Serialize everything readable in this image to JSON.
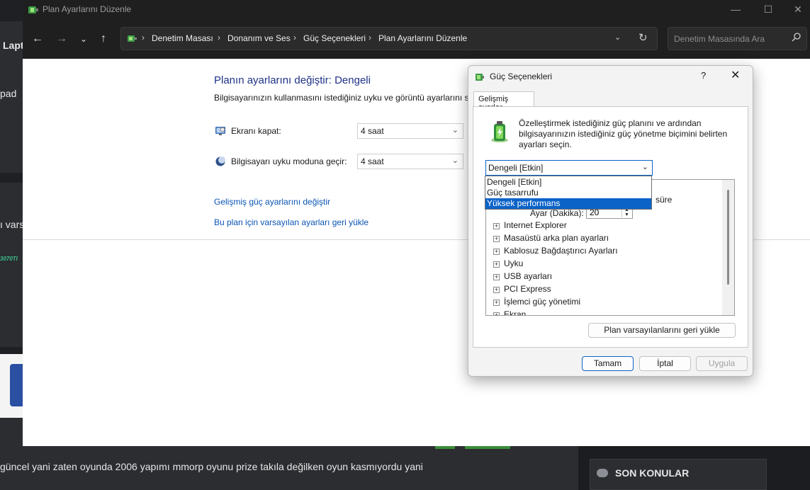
{
  "background": {
    "left_texts": [
      "Lapt",
      "pad",
      "ı vars"
    ],
    "green_code": "3070TI",
    "bottom_text": "güncel yani zaten oyunda 2006 yapımı mmorp oyunu prize takıla değilken oyun kasmıyordu yani",
    "son_konular": "SON KONULAR"
  },
  "window": {
    "title": "Plan Ayarlarını Düzenle",
    "breadcrumbs": [
      "Denetim Masası",
      "Donanım ve Ses",
      "Güç Seçenekleri",
      "Plan Ayarlarını Düzenle"
    ],
    "search_placeholder": "Denetim Masasında Ara"
  },
  "page": {
    "title": "Planın ayarlarını değiştir: Dengeli",
    "description": "Bilgisayarınızın kullanmasını istediğiniz uyku ve görüntü ayarlarını seçin.",
    "settings": [
      {
        "label": "Ekranı kapat:",
        "value": "4 saat",
        "icon": "monitor-icon"
      },
      {
        "label": "Bilgisayarı uyku moduna geçir:",
        "value": "4 saat",
        "icon": "moon-icon"
      }
    ],
    "links": [
      "Gelişmiş güç ayarlarını değiştir",
      "Bu plan için varsayılan ayarları geri yükle"
    ]
  },
  "dialog": {
    "title": "Güç Seçenekleri",
    "help": "?",
    "tab": "Gelişmiş ayarlar",
    "instruction": "Özelleştirmek istediğiniz güç planını ve ardından bilgisayarınızın istediğiniz güç yönetme biçimini belirten ayarları seçin.",
    "selected_plan": "Dengeli [Etkin]",
    "plan_options": [
      "Dengeli [Etkin]",
      "Güç tasarrufu",
      "Yüksek performans"
    ],
    "highlighted_option": "Yüksek performans",
    "partial_text": "süre",
    "sub_setting_label": "Ayar (Dakika):",
    "sub_setting_value": "20",
    "tree_items": [
      "Internet Explorer",
      "Masaüstü arka plan ayarları",
      "Kablosuz Bağdaştırıcı Ayarları",
      "Uyku",
      "USB ayarları",
      "PCI Express",
      "İşlemci güç yönetimi",
      "Ekran"
    ],
    "restore_button": "Plan varsayılanlarını geri yükle",
    "ok_button": "Tamam",
    "cancel_button": "İptal",
    "apply_button": "Uygula"
  },
  "colors": {
    "accent": "#0b63c8",
    "title_blue": "#1e3287",
    "link_blue": "#0a55b5",
    "dark_chrome": "#1f1f1f"
  }
}
